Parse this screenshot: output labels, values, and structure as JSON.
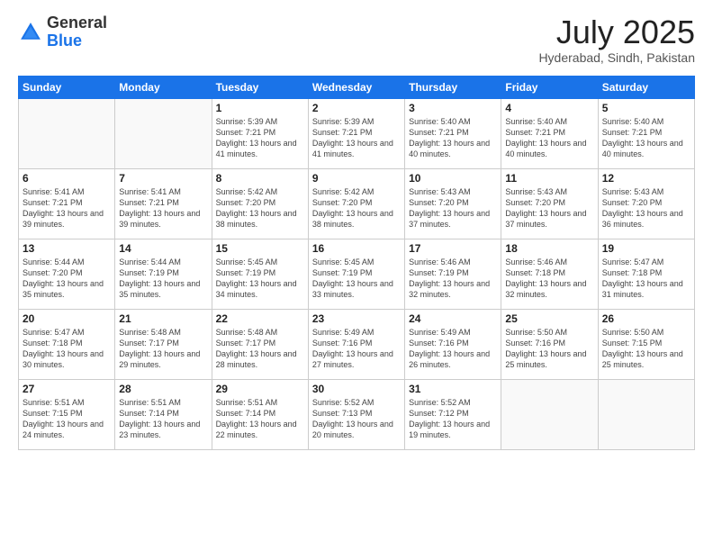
{
  "header": {
    "logo_general": "General",
    "logo_blue": "Blue",
    "month_title": "July 2025",
    "location": "Hyderabad, Sindh, Pakistan"
  },
  "weekdays": [
    "Sunday",
    "Monday",
    "Tuesday",
    "Wednesday",
    "Thursday",
    "Friday",
    "Saturday"
  ],
  "weeks": [
    [
      {
        "day": "",
        "info": ""
      },
      {
        "day": "",
        "info": ""
      },
      {
        "day": "1",
        "info": "Sunrise: 5:39 AM\nSunset: 7:21 PM\nDaylight: 13 hours and 41 minutes."
      },
      {
        "day": "2",
        "info": "Sunrise: 5:39 AM\nSunset: 7:21 PM\nDaylight: 13 hours and 41 minutes."
      },
      {
        "day": "3",
        "info": "Sunrise: 5:40 AM\nSunset: 7:21 PM\nDaylight: 13 hours and 40 minutes."
      },
      {
        "day": "4",
        "info": "Sunrise: 5:40 AM\nSunset: 7:21 PM\nDaylight: 13 hours and 40 minutes."
      },
      {
        "day": "5",
        "info": "Sunrise: 5:40 AM\nSunset: 7:21 PM\nDaylight: 13 hours and 40 minutes."
      }
    ],
    [
      {
        "day": "6",
        "info": "Sunrise: 5:41 AM\nSunset: 7:21 PM\nDaylight: 13 hours and 39 minutes."
      },
      {
        "day": "7",
        "info": "Sunrise: 5:41 AM\nSunset: 7:21 PM\nDaylight: 13 hours and 39 minutes."
      },
      {
        "day": "8",
        "info": "Sunrise: 5:42 AM\nSunset: 7:20 PM\nDaylight: 13 hours and 38 minutes."
      },
      {
        "day": "9",
        "info": "Sunrise: 5:42 AM\nSunset: 7:20 PM\nDaylight: 13 hours and 38 minutes."
      },
      {
        "day": "10",
        "info": "Sunrise: 5:43 AM\nSunset: 7:20 PM\nDaylight: 13 hours and 37 minutes."
      },
      {
        "day": "11",
        "info": "Sunrise: 5:43 AM\nSunset: 7:20 PM\nDaylight: 13 hours and 37 minutes."
      },
      {
        "day": "12",
        "info": "Sunrise: 5:43 AM\nSunset: 7:20 PM\nDaylight: 13 hours and 36 minutes."
      }
    ],
    [
      {
        "day": "13",
        "info": "Sunrise: 5:44 AM\nSunset: 7:20 PM\nDaylight: 13 hours and 35 minutes."
      },
      {
        "day": "14",
        "info": "Sunrise: 5:44 AM\nSunset: 7:19 PM\nDaylight: 13 hours and 35 minutes."
      },
      {
        "day": "15",
        "info": "Sunrise: 5:45 AM\nSunset: 7:19 PM\nDaylight: 13 hours and 34 minutes."
      },
      {
        "day": "16",
        "info": "Sunrise: 5:45 AM\nSunset: 7:19 PM\nDaylight: 13 hours and 33 minutes."
      },
      {
        "day": "17",
        "info": "Sunrise: 5:46 AM\nSunset: 7:19 PM\nDaylight: 13 hours and 32 minutes."
      },
      {
        "day": "18",
        "info": "Sunrise: 5:46 AM\nSunset: 7:18 PM\nDaylight: 13 hours and 32 minutes."
      },
      {
        "day": "19",
        "info": "Sunrise: 5:47 AM\nSunset: 7:18 PM\nDaylight: 13 hours and 31 minutes."
      }
    ],
    [
      {
        "day": "20",
        "info": "Sunrise: 5:47 AM\nSunset: 7:18 PM\nDaylight: 13 hours and 30 minutes."
      },
      {
        "day": "21",
        "info": "Sunrise: 5:48 AM\nSunset: 7:17 PM\nDaylight: 13 hours and 29 minutes."
      },
      {
        "day": "22",
        "info": "Sunrise: 5:48 AM\nSunset: 7:17 PM\nDaylight: 13 hours and 28 minutes."
      },
      {
        "day": "23",
        "info": "Sunrise: 5:49 AM\nSunset: 7:16 PM\nDaylight: 13 hours and 27 minutes."
      },
      {
        "day": "24",
        "info": "Sunrise: 5:49 AM\nSunset: 7:16 PM\nDaylight: 13 hours and 26 minutes."
      },
      {
        "day": "25",
        "info": "Sunrise: 5:50 AM\nSunset: 7:16 PM\nDaylight: 13 hours and 25 minutes."
      },
      {
        "day": "26",
        "info": "Sunrise: 5:50 AM\nSunset: 7:15 PM\nDaylight: 13 hours and 25 minutes."
      }
    ],
    [
      {
        "day": "27",
        "info": "Sunrise: 5:51 AM\nSunset: 7:15 PM\nDaylight: 13 hours and 24 minutes."
      },
      {
        "day": "28",
        "info": "Sunrise: 5:51 AM\nSunset: 7:14 PM\nDaylight: 13 hours and 23 minutes."
      },
      {
        "day": "29",
        "info": "Sunrise: 5:51 AM\nSunset: 7:14 PM\nDaylight: 13 hours and 22 minutes."
      },
      {
        "day": "30",
        "info": "Sunrise: 5:52 AM\nSunset: 7:13 PM\nDaylight: 13 hours and 20 minutes."
      },
      {
        "day": "31",
        "info": "Sunrise: 5:52 AM\nSunset: 7:12 PM\nDaylight: 13 hours and 19 minutes."
      },
      {
        "day": "",
        "info": ""
      },
      {
        "day": "",
        "info": ""
      }
    ]
  ]
}
